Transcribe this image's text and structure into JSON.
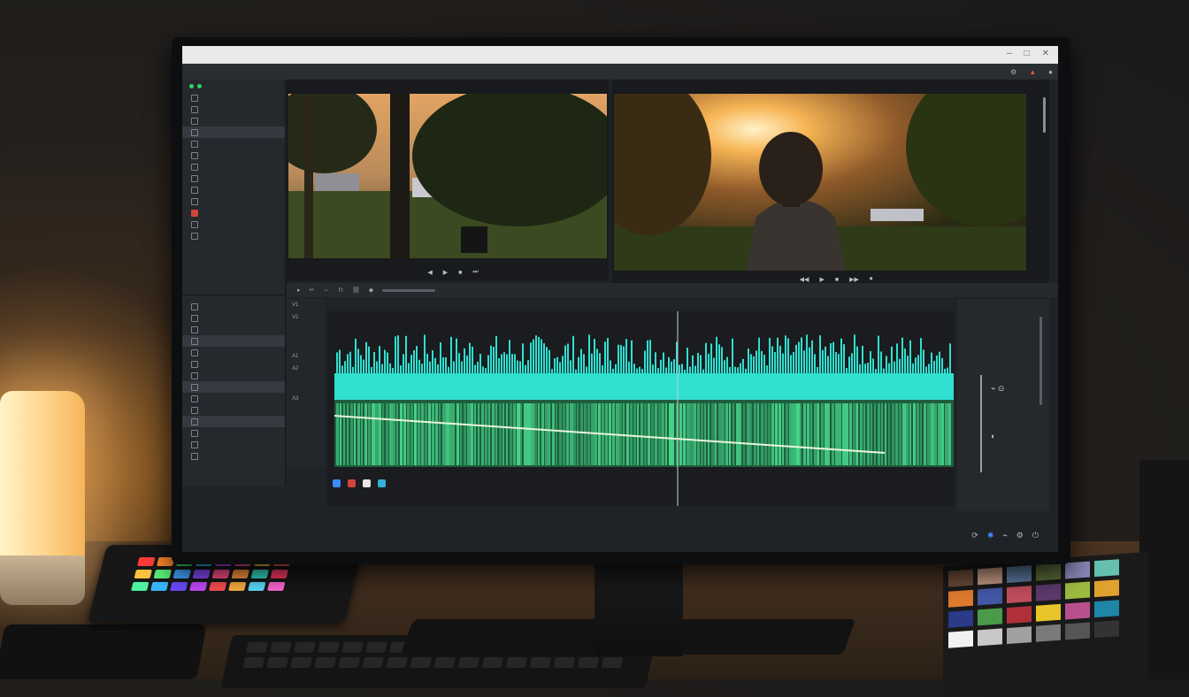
{
  "window": {
    "title_blurred": "",
    "controls": [
      "–",
      "□",
      "✕"
    ]
  },
  "menubar": {
    "items": [
      "",
      "",
      "",
      "",
      ""
    ],
    "right_icons": [
      "settings-icon",
      "help-icon",
      "user-icon"
    ]
  },
  "sidebar": {
    "top_items": [
      "",
      "",
      "",
      "",
      "",
      "",
      "",
      "",
      "",
      "",
      "",
      "",
      ""
    ],
    "bottom_items": [
      "",
      "",
      "",
      "",
      "",
      "",
      "",
      "",
      "",
      "",
      "",
      "",
      "",
      ""
    ]
  },
  "source_viewer": {
    "header": "",
    "timecode": "",
    "controls": [
      "◀",
      "▶",
      "■",
      "⏭"
    ]
  },
  "program_viewer": {
    "header": "",
    "timecode": "",
    "controls": [
      "◀◀",
      "▶",
      "■",
      "▶▶",
      "⏺"
    ]
  },
  "timeline": {
    "tracks": [
      "V1",
      "V2",
      "A1",
      "A2",
      "A3"
    ]
  },
  "colors": {
    "waveform_top": "#2fe0d0",
    "waveform_bottom": "#46d58a",
    "accent": "#3d8cff",
    "record": "#d0453a"
  },
  "page": {
    "brand": ""
  }
}
